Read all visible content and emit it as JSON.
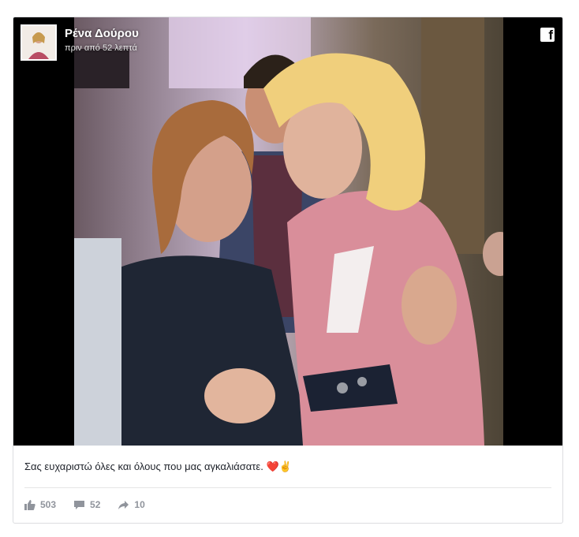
{
  "post": {
    "page_name": "Ρένα Δούρου",
    "timestamp": "πριν από 52 λεπτά",
    "caption": "Σας ευχαριστώ όλες και όλους που μας αγκαλιάσατε. ❤️✌️",
    "likes": "503",
    "comments": "52",
    "shares": "10",
    "brand_icon": "facebook-icon"
  },
  "icons": {
    "like": "thumbs-up-icon",
    "comment": "comment-icon",
    "share": "share-arrow-icon"
  }
}
